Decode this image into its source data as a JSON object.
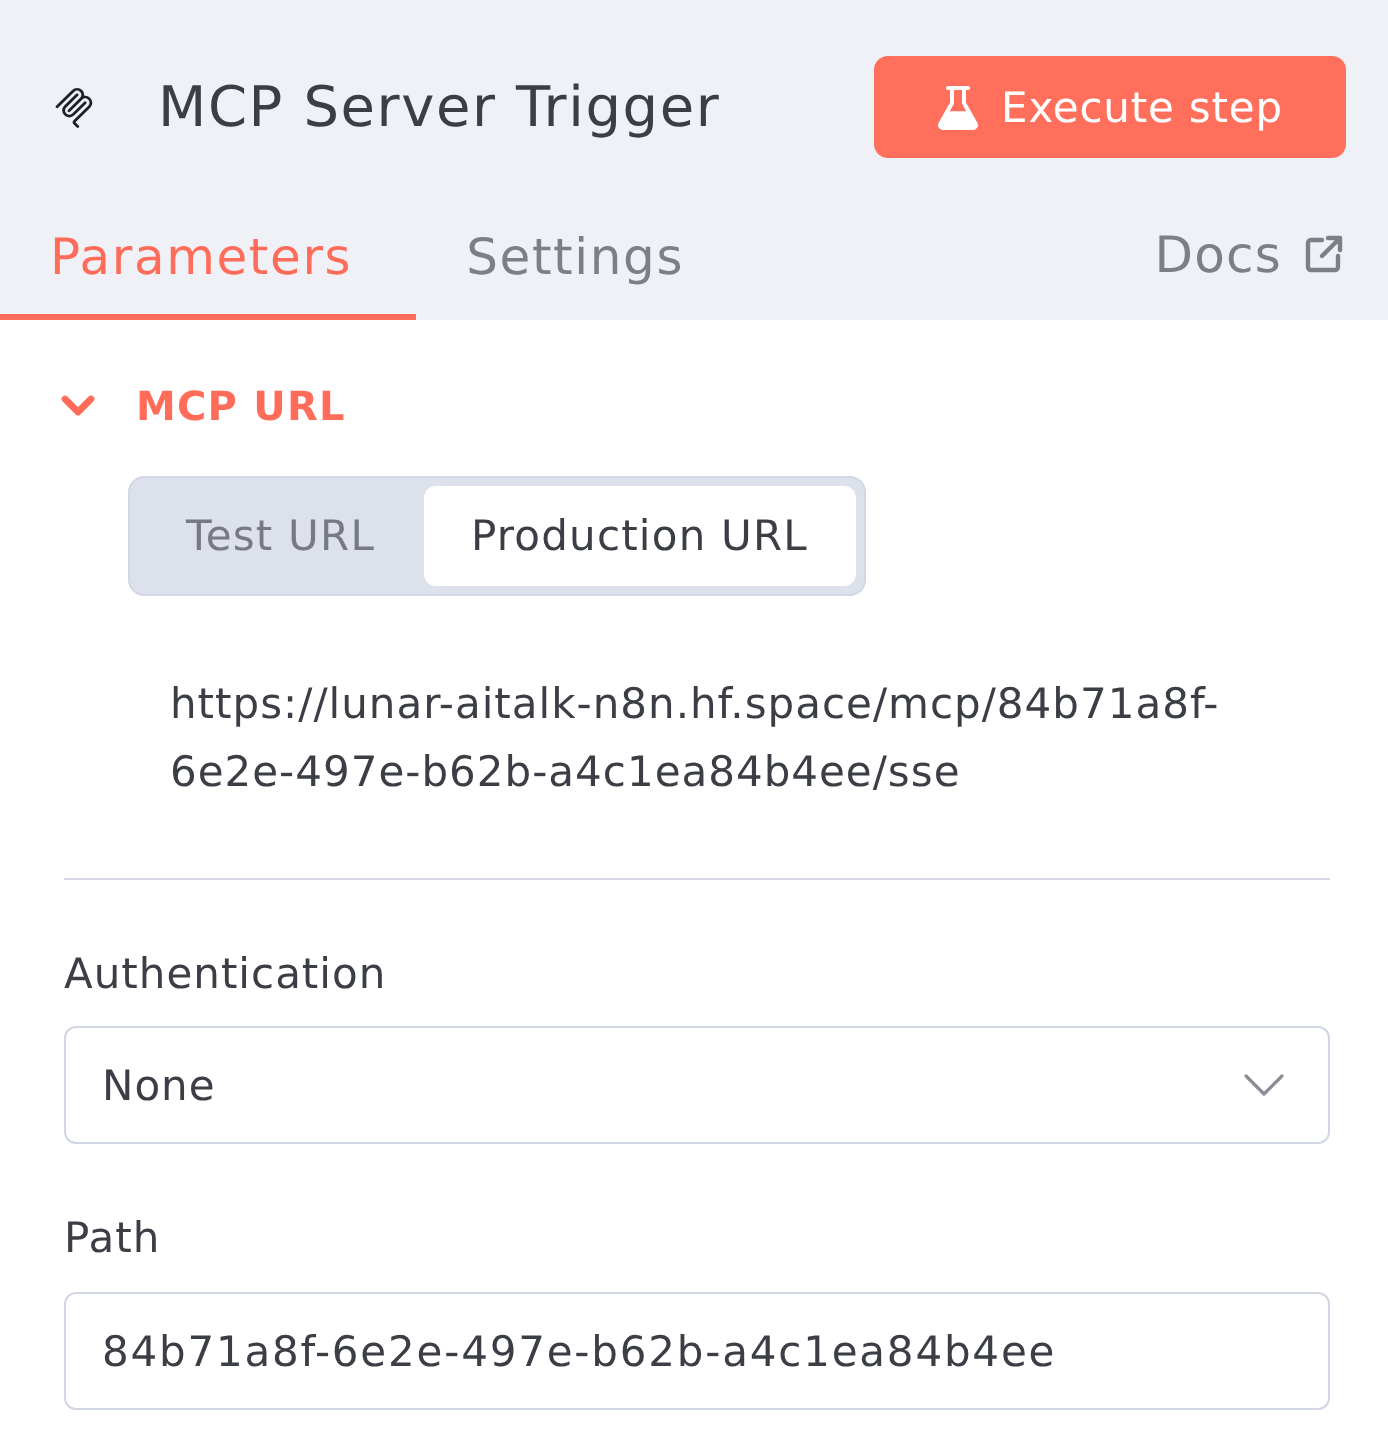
{
  "header": {
    "title": "MCP Server Trigger",
    "execute_button": "Execute step"
  },
  "tabs": [
    {
      "label": "Parameters",
      "selected": true
    },
    {
      "label": "Settings",
      "selected": false
    }
  ],
  "docs_link": "Docs",
  "section": {
    "title": "MCP URL",
    "expanded": true,
    "url_tabs": [
      {
        "label": "Test URL",
        "selected": false
      },
      {
        "label": "Production URL",
        "selected": true
      }
    ],
    "url": "https://lunar-aitalk-n8n.hf.space/mcp/84b71a8f-6e2e-497e-b62b-a4c1ea84b4ee/sse"
  },
  "fields": [
    {
      "kind": "select",
      "label": "Authentication",
      "value": "None"
    },
    {
      "kind": "input",
      "label": "Path",
      "value": "84b71a8f-6e2e-497e-b62b-a4c1ea84b4ee"
    }
  ]
}
